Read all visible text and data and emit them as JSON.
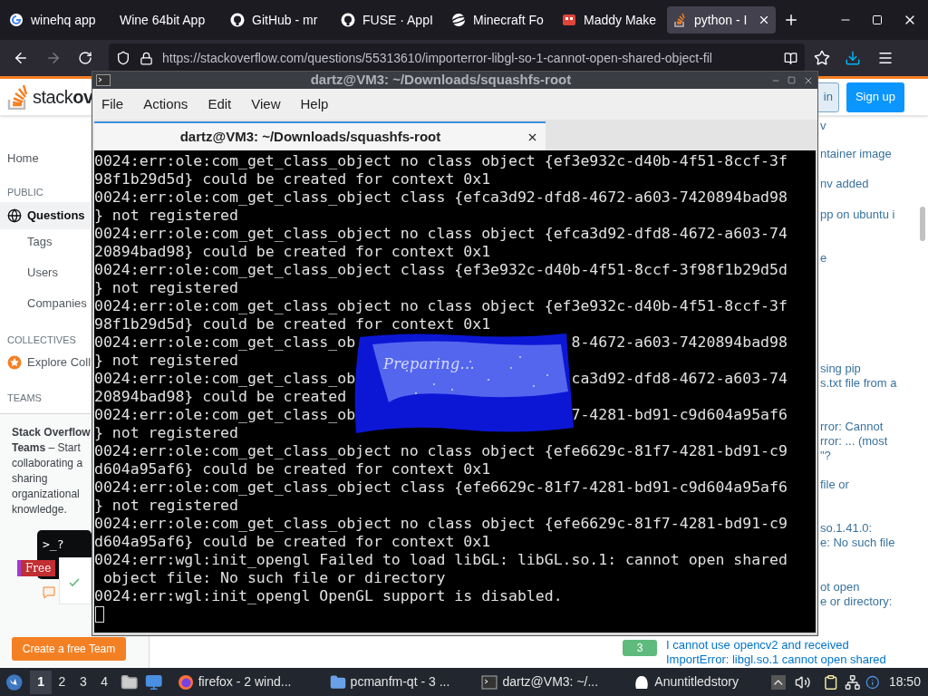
{
  "browser": {
    "tabs": [
      {
        "title": "winehq app",
        "kind": "google",
        "selected": false
      },
      {
        "title": "Wine 64bit App",
        "selected": false
      },
      {
        "title": "GitHub - mr",
        "kind": "github",
        "selected": false
      },
      {
        "title": "FUSE · AppI",
        "kind": "github",
        "selected": false
      },
      {
        "title": "Minecraft Fo",
        "kind": "planet",
        "selected": false
      },
      {
        "title": "Maddy Make",
        "kind": "game",
        "selected": false
      },
      {
        "title": "python - I",
        "kind": "stack",
        "selected": true
      }
    ],
    "url": "https://stackoverflow.com/questions/55313610/importerror-libgl-so-1-cannot-open-shared-object-fil"
  },
  "page": {
    "logo": "stack**ov**",
    "login": "in",
    "signup": "Sign up",
    "sidebar": [
      {
        "kind": "link",
        "label": "Home",
        "selected": false
      },
      {
        "kind": "heading",
        "label": "PUBLIC"
      },
      {
        "kind": "link",
        "label": "Questions",
        "selected": true
      },
      {
        "kind": "sublink",
        "label": "Tags",
        "selected": false
      },
      {
        "kind": "sublink",
        "label": "Users",
        "selected": false
      },
      {
        "kind": "sublink",
        "label": "Companies",
        "selected": false
      },
      {
        "kind": "heading",
        "label": "COLLECTIVES"
      },
      {
        "kind": "collective",
        "label": "Explore Coll"
      },
      {
        "kind": "heading",
        "label": "TEAMS"
      }
    ],
    "teams_card": {
      "text": "**Stack Overflow**\n**Teams** – Start\ncollaborating a\nsharing\norganizational\nknowledge.",
      "prompt": ">_?",
      "badge": "Free",
      "button": "Create a free Team"
    },
    "related": [
      "v",
      "ntainer image",
      "nv added",
      "pp on ubuntu i",
      "e",
      "sing pip\ns.txt file from a",
      "rror: Cannot\nrror: ... (most\n\"?",
      "file or",
      "so.1.41.0:\ne: No such file",
      "ot open\ne or directory:"
    ],
    "bottom_question": {
      "score": "3",
      "title": "I cannot use opencv2 and received\nImportError: libgl.so.1 cannot open shared"
    }
  },
  "terminal": {
    "title": "dartz@VM3: ~/Downloads/squashfs-root",
    "menu": [
      "File",
      "Actions",
      "Edit",
      "View",
      "Help"
    ],
    "tab": "dartz@VM3: ~/Downloads/squashfs-root",
    "lines": [
      {
        "text": "0024:err:ole:com_get_class_object no class object {ef3e932c-d40b-4f51-8ccf-3f"
      },
      {
        "text": "98f1b29d5d} could be created for context 0x1"
      },
      {
        "text": "0024:err:ole:com_get_class_object class {efca3d92-dfd8-4672-a603-7420894bad98"
      },
      {
        "text": "} not registered"
      },
      {
        "text": "0024:err:ole:com_get_class_object no class object {efca3d92-dfd8-4672-a603-74"
      },
      {
        "text": "20894bad98} could be created for context 0x1"
      },
      {
        "text": "0024:err:ole:com_get_class_object class {ef3e932c-d40b-4f51-8ccf-3f98f1b29d5d"
      },
      {
        "text": "} not registered"
      },
      {
        "text": "0024:err:ole:com_get_class_object no class object {ef3e932c-d40b-4f51-8ccf-3f"
      },
      {
        "text": "98f1b29d5d} could be created for context 0x1"
      },
      {
        "text": "0024:err:ole:com_get_class_ob",
        "right": "8-4672-a603-7420894bad98"
      },
      {
        "text": "} not registered"
      },
      {
        "text": "0024:err:ole:com_get_class_ob",
        "right": "ca3d92-dfd8-4672-a603-74"
      },
      {
        "text": "20894bad98} could be created"
      },
      {
        "text": "0024:err:ole:com_get_class_ob",
        "right": "7-4281-bd91-c9d604a95af6"
      },
      {
        "text": "} not registered"
      },
      {
        "text": "0024:err:ole:com_get_class_object no class object {efe6629c-81f7-4281-bd91-c9"
      },
      {
        "text": "d604a95af6} could be created for context 0x1"
      },
      {
        "text": "0024:err:ole:com_get_class_object class {efe6629c-81f7-4281-bd91-c9d604a95af6"
      },
      {
        "text": "} not registered"
      },
      {
        "text": "0024:err:ole:com_get_class_object no class object {efe6629c-81f7-4281-bd91-c9"
      },
      {
        "text": "d604a95af6} could be created for context 0x1"
      },
      {
        "text": "0024:err:wgl:init_opengl Failed to load libGL: libGL.so.1: cannot open shared"
      },
      {
        "text": " object file: No such file or directory"
      },
      {
        "text": "0024:err:wgl:init_opengl OpenGL support is disabled."
      }
    ],
    "splash": "Preparing..."
  },
  "taskbar": {
    "workspaces": [
      {
        "label": "1",
        "selected": true
      },
      {
        "label": "2",
        "selected": false
      },
      {
        "label": "3",
        "selected": false
      },
      {
        "label": "4",
        "selected": false
      }
    ],
    "tasks": [
      {
        "label": "firefox - 2 wind...",
        "kind": "firefox"
      },
      {
        "label": "pcmanfm-qt - 3 ...",
        "kind": "folder"
      },
      {
        "label": "dartz@VM3: ~/...",
        "kind": "terminal"
      },
      {
        "label": "Anuntitledstory",
        "kind": "blob"
      }
    ],
    "clock": "18:50"
  }
}
